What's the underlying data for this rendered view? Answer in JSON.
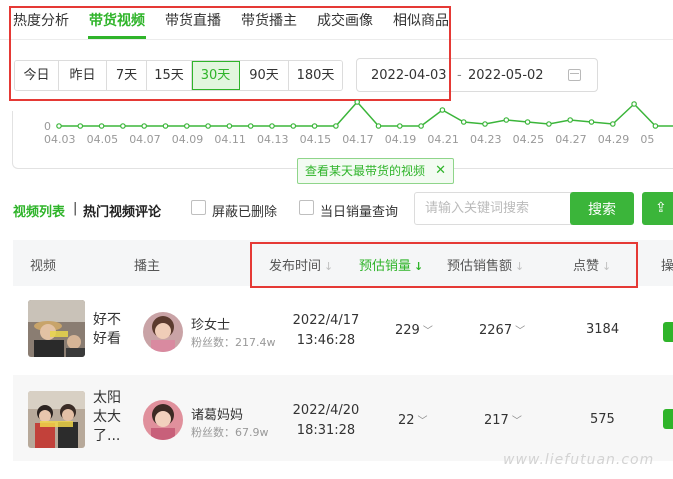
{
  "tabs": [
    {
      "label": "热度分析",
      "active": false
    },
    {
      "label": "带货视频",
      "active": true
    },
    {
      "label": "带货直播",
      "active": false
    },
    {
      "label": "带货播主",
      "active": false
    },
    {
      "label": "成交画像",
      "active": false
    },
    {
      "label": "相似商品",
      "active": false
    }
  ],
  "periods": [
    {
      "label": "今日",
      "active": false
    },
    {
      "label": "昨日",
      "active": false
    },
    {
      "label": "7天",
      "active": false
    },
    {
      "label": "15天",
      "active": false
    },
    {
      "label": "30天",
      "active": true
    },
    {
      "label": "90天",
      "active": false
    },
    {
      "label": "180天",
      "active": false
    }
  ],
  "date_range": {
    "start": "2022-04-03",
    "separator": "-",
    "end": "2022-05-02"
  },
  "chart_data": {
    "type": "line",
    "y_tick_visible": "0",
    "x": [
      "04.03",
      "04.05",
      "04.07",
      "04.09",
      "04.11",
      "04.13",
      "04.15",
      "04.17",
      "04.19",
      "04.21",
      "04.23",
      "04.25",
      "04.27",
      "04.29",
      "05"
    ],
    "color": "#3bb53a"
  },
  "tooltip": {
    "label": "查看某天最带货的视频",
    "close": "✕"
  },
  "list": {
    "tab_video_list": "视频列表",
    "divider": "|",
    "tab_hot_comments": "热门视频评论",
    "hide_deleted": "屏蔽已删除",
    "same_day_sales": "当日销量查询",
    "search_placeholder": "请输入关键词搜索",
    "search_button": "搜索",
    "export_icon": "⇪"
  },
  "table": {
    "headers": {
      "video": "视频",
      "anchor": "播主",
      "publish_time": "发布时间",
      "est_sales": "预估销量",
      "est_revenue": "预估销售额",
      "likes": "点赞",
      "op": "操"
    },
    "rows": [
      {
        "title": "好不好看",
        "anchor": "珍女士",
        "fans": "粉丝数：217.4w",
        "date": "2022/4/17",
        "time": "13:46:28",
        "sales": "229",
        "revenue": "2267",
        "likes": "3184"
      },
      {
        "title": "太阳太大了...",
        "anchor": "诸葛妈妈",
        "fans": "粉丝数：67.9w",
        "date": "2022/4/20",
        "time": "18:31:28",
        "sales": "22",
        "revenue": "217",
        "likes": "575"
      }
    ]
  },
  "watermark": "www.liefutuan.com",
  "accent_color": "#2fb42a"
}
